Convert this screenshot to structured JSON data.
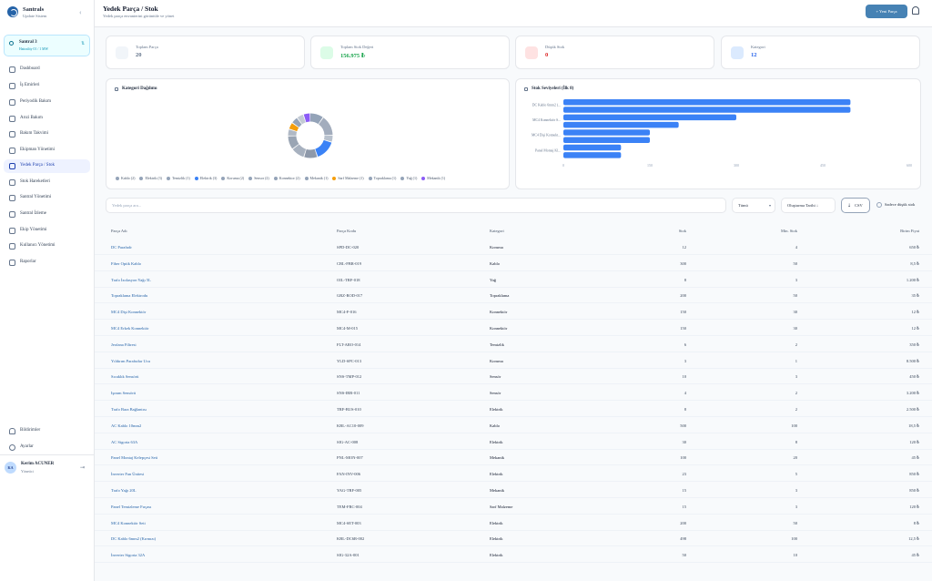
{
  "app": {
    "brand": "Santrals",
    "brand_sub": "Update Sistem"
  },
  "site": {
    "name": "Santral 3",
    "sub": "Hattrality 01 / 1 MW"
  },
  "nav": [
    {
      "label": "Dashboard"
    },
    {
      "label": "İş Emirleri"
    },
    {
      "label": "Periyodik Bakım"
    },
    {
      "label": "Arızi Bakım"
    },
    {
      "label": "Bakım Takvimi"
    },
    {
      "label": "Ekipman Yönetimi"
    },
    {
      "label": "Yedek Parça / Stok"
    },
    {
      "label": "Stok Hareketleri"
    },
    {
      "label": "Santral Yönetimi"
    },
    {
      "label": "Santral İzleme"
    },
    {
      "label": "Ekip Yönetimi"
    },
    {
      "label": "Kullanıcı Yönetimi"
    },
    {
      "label": "Raporlar"
    }
  ],
  "nav_bottom": [
    {
      "label": "Bildirimler"
    },
    {
      "label": "Ayarlar"
    }
  ],
  "user": {
    "initials": "KA",
    "name": "Kerim ACUNER",
    "role": "Yönetici"
  },
  "header": {
    "title": "Yedek Parça / Stok",
    "subtitle": "Yedek parça envanterini görüntüle ve yönet",
    "new_button": "Yeni Parça"
  },
  "stats": [
    {
      "label": "Toplam Parça",
      "value": "20",
      "color": "#64748b",
      "bg": "#f1f5f9"
    },
    {
      "label": "Toplam Stok Değeri",
      "value": "156.975 ₺",
      "color": "#16a34a",
      "bg": "#dcfce7"
    },
    {
      "label": "Düşük Stok",
      "value": "0",
      "color": "#dc2626",
      "bg": "#fee2e2"
    },
    {
      "label": "Kategori",
      "value": "12",
      "color": "#2563eb",
      "bg": "#dbeafe"
    }
  ],
  "donut": {
    "title": "Kategori Dağılımı",
    "legend": [
      {
        "label": "Kablo (2)",
        "color": "#94a3b8"
      },
      {
        "label": "Elektrik (3)",
        "color": "#94a3b8"
      },
      {
        "label": "Temizlik (1)",
        "color": "#94a3b8"
      },
      {
        "label": "Elektrik (3)",
        "color": "#3b82f6"
      },
      {
        "label": "Koruma (2)",
        "color": "#94a3b8"
      },
      {
        "label": "Sensor (2)",
        "color": "#94a3b8"
      },
      {
        "label": "Konnektor (2)",
        "color": "#94a3b8"
      },
      {
        "label": "Mekanik (1)",
        "color": "#94a3b8"
      },
      {
        "label": "Sarf Malzeme (1)",
        "color": "#f59e0b"
      },
      {
        "label": "Topraklama (1)",
        "color": "#94a3b8"
      },
      {
        "label": "Yağ (1)",
        "color": "#94a3b8"
      },
      {
        "label": "Mekanik (1)",
        "color": "#8b5cf6"
      }
    ]
  },
  "chart_data": {
    "type": "bar",
    "orientation": "horizontal",
    "title": "Stok Seviyeleri (İlk 8)",
    "categories": [
      "DC Kablo 6mm2 (...",
      "",
      "MC4 Konnektör S...",
      "",
      "MC4 Dişi Konnekt...",
      "",
      "Panel Montaj Kl...",
      ""
    ],
    "values": [
      498,
      498,
      300,
      200,
      150,
      150,
      100,
      100
    ],
    "xlim": [
      0,
      600
    ],
    "xticks": [
      "0",
      "150",
      "300",
      "450",
      "600"
    ],
    "color": "#3b82f6",
    "grid": false
  },
  "filters": {
    "search_placeholder": "Yedek parça ara...",
    "category": "Tümü",
    "sort": "Oluşturma Tarihi ↓",
    "csv": "CSV",
    "low_stock": "Sadece düşük stok"
  },
  "table": {
    "headers": [
      "Parça Adı",
      "Parça Kodu",
      "Kategori",
      "Stok",
      "Min. Stok",
      "Birim Fiyat"
    ],
    "rows": [
      [
        "DC Parafudr",
        "SPD-DC-020",
        "Koruma",
        "12",
        "4",
        "650 ₺"
      ],
      [
        "Fiber Optik Kablo",
        "CBL-FBR-019",
        "Kablo",
        "300",
        "50",
        "8,5 ₺"
      ],
      [
        "Trafo İzolasyon Yağı 5L",
        "OIL-TRF-018",
        "Yağ",
        "8",
        "3",
        "1.200 ₺"
      ],
      [
        "Topraklama Elektrodu",
        "GRZ-ROD-017",
        "Topraklama",
        "200",
        "50",
        "35 ₺"
      ],
      [
        "MC4 Dişi Konnektör",
        "MC4-F-016",
        "Konnektör",
        "150",
        "30",
        "12 ₺"
      ],
      [
        "MC4 Erkek Konnektör",
        "MC4-M-015",
        "Konnektör",
        "150",
        "30",
        "12 ₺"
      ],
      [
        "Jeofana Filtresi",
        "FLT-ARO-014",
        "Temizlik",
        "6",
        "2",
        "350 ₺"
      ],
      [
        "Yıldırım Parafudur Ucu",
        "YLD-SPC-013",
        "Koruma",
        "3",
        "1",
        "8.500 ₺"
      ],
      [
        "Sıcaklık Sensörü",
        "SNS-TMP-012",
        "Sensör",
        "10",
        "3",
        "450 ₺"
      ],
      [
        "Işınım Sensörü",
        "SNS-IRR-011",
        "Sensör",
        "4",
        "2",
        "3.200 ₺"
      ],
      [
        "Trafo Bara Bağlantısı",
        "TRF-BUS-010",
        "Elektrik",
        "8",
        "2",
        "2.500 ₺"
      ],
      [
        "AC Kablo 10mm2",
        "KBL-AC10-009",
        "Kablo",
        "500",
        "100",
        "18,5 ₺"
      ],
      [
        "AC Sigorta 63A",
        "SIG-AC-008",
        "Elektrik",
        "30",
        "8",
        "120 ₺"
      ],
      [
        "Panel Montaj Kelepçesi Seti",
        "PNL-MON-007",
        "Mekanik",
        "100",
        "20",
        "45 ₺"
      ],
      [
        "İnverter Fan Ünitesi",
        "FAN-INV-006",
        "Elektrik",
        "23",
        "5",
        "850 ₺"
      ],
      [
        "Trafo Yağı 20L",
        "YAG-TRF-005",
        "Mekanik",
        "15",
        "3",
        "850 ₺"
      ],
      [
        "Panel Temizleme Fırçası",
        "TEM-FRC-004",
        "Sarf Malzeme",
        "15",
        "3",
        "120 ₺"
      ],
      [
        "MC4 Konnektör Seti",
        "MC4-SET-003",
        "Elektrik",
        "200",
        "50",
        "8 ₺"
      ],
      [
        "DC Kablo 6mm2 (Kırmızı)",
        "KBL-DC6R-002",
        "Elektrik",
        "498",
        "100",
        "12,5 ₺"
      ],
      [
        "İnverter Sigorta 32A",
        "SIG-32A-001",
        "Elektrik",
        "50",
        "10",
        "45 ₺"
      ]
    ]
  }
}
